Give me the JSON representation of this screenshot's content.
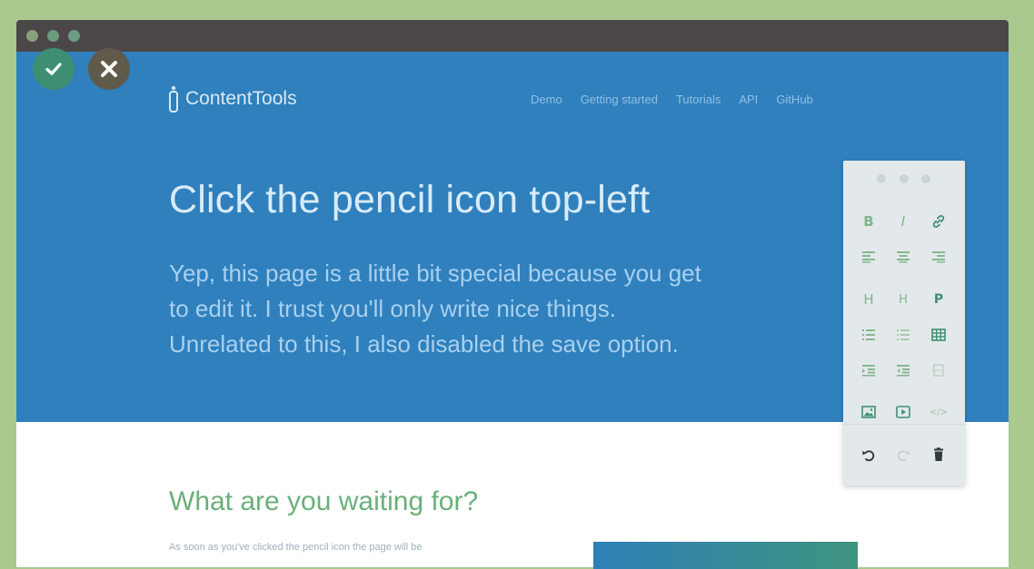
{
  "app": {
    "logo_text": "ContentTools"
  },
  "nav": [
    "Demo",
    "Getting started",
    "Tutorials",
    "API",
    "GitHub"
  ],
  "hero": {
    "title": "Click the pencil icon top-left",
    "lines": [
      "Yep, this page is a little bit special because you get",
      "to edit it. I trust you'll only write nice things.",
      "Unrelated to this, I also disabled the save option."
    ]
  },
  "section": {
    "title": "What are you waiting for?",
    "text": "As soon as you've clicked the pencil icon the page will be"
  },
  "toolbox": {
    "tools": [
      {
        "name": "bold-tool",
        "glyph": "B"
      },
      {
        "name": "italic-tool",
        "glyph": "I"
      },
      {
        "name": "link-tool",
        "icon": "link-icon"
      },
      {
        "name": "align-left-tool",
        "icon": "align-left-icon"
      },
      {
        "name": "align-center-tool",
        "icon": "align-center-icon"
      },
      {
        "name": "align-right-tool",
        "icon": "align-right-icon"
      },
      {
        "name": "heading-tool",
        "glyph": "H"
      },
      {
        "name": "subheading-tool",
        "glyph": "H"
      },
      {
        "name": "paragraph-tool",
        "glyph": "P"
      },
      {
        "name": "unordered-list-tool",
        "icon": "unordered-list-icon"
      },
      {
        "name": "ordered-list-tool",
        "icon": "ordered-list-icon"
      },
      {
        "name": "table-tool",
        "icon": "table-icon"
      },
      {
        "name": "indent-tool",
        "icon": "indent-icon"
      },
      {
        "name": "unindent-tool",
        "icon": "unindent-icon"
      },
      {
        "name": "line-break-tool",
        "icon": "line-break-icon"
      },
      {
        "name": "image-tool",
        "icon": "image-icon"
      },
      {
        "name": "video-tool",
        "icon": "video-icon"
      },
      {
        "name": "preformatted-tool",
        "glyph": "</>"
      },
      {
        "name": "undo-tool",
        "icon": "undo-icon"
      },
      {
        "name": "redo-tool",
        "icon": "redo-icon"
      },
      {
        "name": "remove-tool",
        "icon": "trash-icon"
      }
    ]
  },
  "colors": {
    "hero_bg": "#2f80bd",
    "accent_green": "#3e8f71",
    "page_bg": "#a9c98f"
  }
}
